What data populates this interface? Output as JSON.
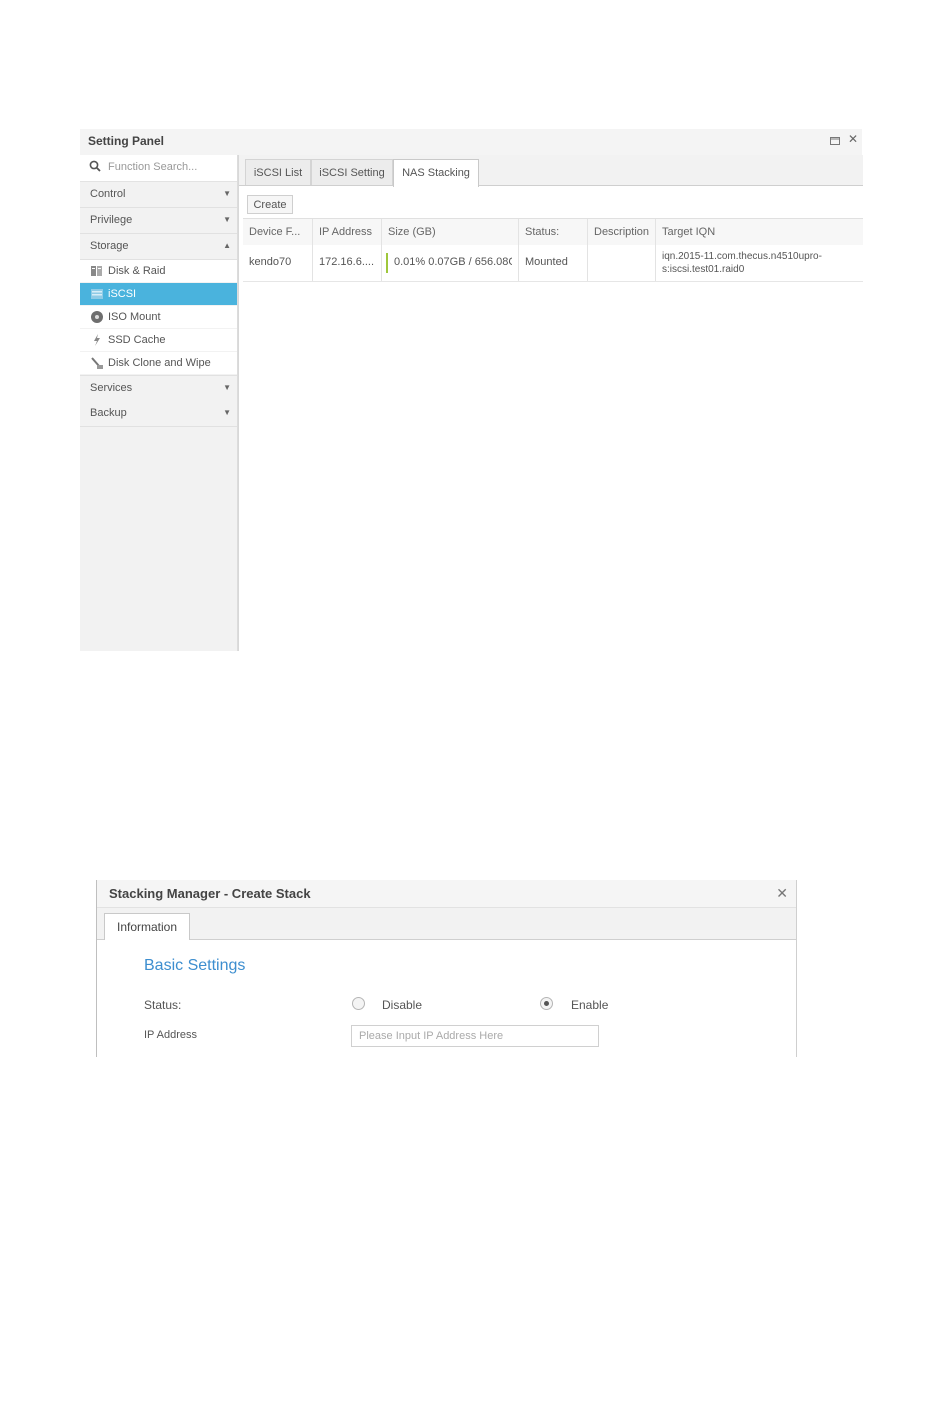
{
  "setting_panel": {
    "title": "Setting Panel",
    "window_buttons": [
      "restore-icon",
      "close-icon"
    ],
    "search": {
      "placeholder": "Function Search..."
    },
    "sections": [
      {
        "label": "Control",
        "arrow": "▼"
      },
      {
        "label": "Privilege",
        "arrow": "▼"
      },
      {
        "label": "Storage",
        "arrow": "▲"
      },
      {
        "label": "Services",
        "arrow": "▼"
      },
      {
        "label": "Backup",
        "arrow": "▼"
      }
    ],
    "storage_items": [
      {
        "label": "Disk & Raid",
        "icon": "disk-raid-icon"
      },
      {
        "label": "iSCSI",
        "icon": "iscsi-icon",
        "active": true
      },
      {
        "label": "ISO Mount",
        "icon": "iso-mount-icon"
      },
      {
        "label": "SSD Cache",
        "icon": "ssd-cache-icon"
      },
      {
        "label": "Disk Clone and Wipe",
        "icon": "disk-clone-icon"
      }
    ],
    "tabs": [
      {
        "label": "iSCSI List"
      },
      {
        "label": "iSCSI Setting"
      },
      {
        "label": "NAS Stacking",
        "active": true
      }
    ],
    "create_label": "Create",
    "table": {
      "columns": [
        "Device F...",
        "IP Address",
        "Size (GB)",
        "Status:",
        "Description",
        "Target IQN"
      ],
      "rows": [
        {
          "device": "kendo70",
          "ip": "172.16.6....",
          "size": "0.01%   0.07GB / 656.08GB",
          "usage_fraction": 0.0001,
          "status": "Mounted",
          "description": "",
          "target_iqn": "iqn.2015-11.com.thecus.n4510upro-s:iscsi.test01.raid0"
        }
      ]
    },
    "accent_color": "#4ab3dd"
  },
  "stacking_manager": {
    "title": "Stacking Manager - Create Stack",
    "tab_label": "Information",
    "section_title": "Basic Settings",
    "status_label": "Status:",
    "disable_label": "Disable",
    "enable_label": "Enable",
    "selected": "Enable",
    "ip_label": "IP Address",
    "ip_placeholder": "Please Input IP Address Here",
    "ip_value": ""
  }
}
